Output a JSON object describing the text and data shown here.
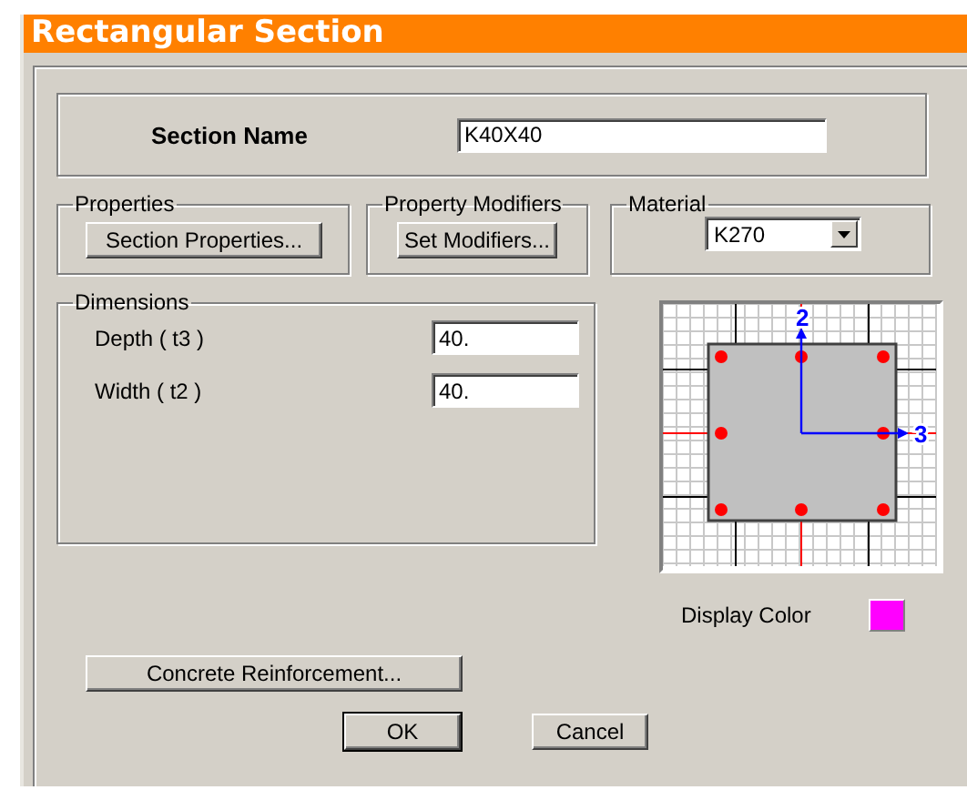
{
  "window": {
    "title": "Rectangular Section"
  },
  "section_name": {
    "label": "Section Name",
    "value": "K40X40"
  },
  "properties": {
    "legend": "Properties",
    "button": "Section Properties..."
  },
  "property_modifiers": {
    "legend": "Property Modifiers",
    "button": "Set Modifiers..."
  },
  "material": {
    "legend": "Material",
    "value": "K270"
  },
  "dimensions": {
    "legend": "Dimensions",
    "fields": [
      {
        "label": "Depth ( t3 )",
        "value": "40."
      },
      {
        "label": "Width ( t2 )",
        "value": "40."
      }
    ]
  },
  "diagram": {
    "axis_labels": [
      "2",
      "3"
    ]
  },
  "display_color": {
    "label": "Display Color",
    "color": "#ff00ff"
  },
  "reinforcement_button": "Concrete Reinforcement...",
  "dialog_buttons": [
    {
      "label": "OK",
      "default": true
    },
    {
      "label": "Cancel",
      "default": false
    }
  ]
}
